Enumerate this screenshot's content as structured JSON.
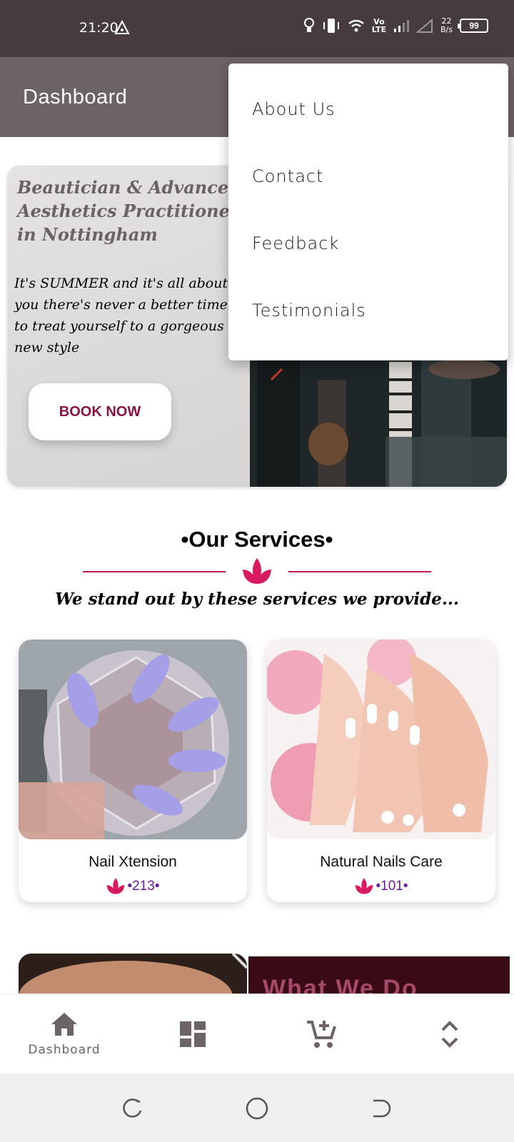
{
  "status_bar": {
    "time": "21:20",
    "volte": "Vo\nLTE",
    "net_speed_value": "22",
    "net_speed_unit": "B/s",
    "battery": "99"
  },
  "app_bar": {
    "title": "Dashboard"
  },
  "overflow_menu": {
    "items": [
      {
        "label": "About Us"
      },
      {
        "label": "Contact"
      },
      {
        "label": "Feedback"
      },
      {
        "label": "Testimonials"
      }
    ]
  },
  "hero": {
    "heading": "Beautician & Advanced Aesthetics Practitioner in Nottingham",
    "text": "It's SUMMER and it's all about you there's never a better time to treat yourself to a gorgeous new style",
    "book_button": "BOOK NOW"
  },
  "services": {
    "title": "•Our Services•",
    "subtitle": "We stand out by these services we provide...",
    "accent_color": "#d81b60",
    "cards": [
      {
        "name": "Nail Xtension",
        "count": "•213•"
      },
      {
        "name": "Natural Nails Care",
        "count": "•101•"
      }
    ],
    "next_section_peek": "What We Do"
  },
  "bottom_nav": {
    "items": [
      {
        "icon": "home-icon",
        "label": "Dashboard"
      },
      {
        "icon": "dashboard-grid-icon",
        "label": ""
      },
      {
        "icon": "add-to-cart-icon",
        "label": ""
      },
      {
        "icon": "unfold-icon",
        "label": ""
      }
    ]
  },
  "system_nav": {
    "icons": [
      "recent-apps-icon",
      "home-circle-icon",
      "back-icon"
    ]
  }
}
